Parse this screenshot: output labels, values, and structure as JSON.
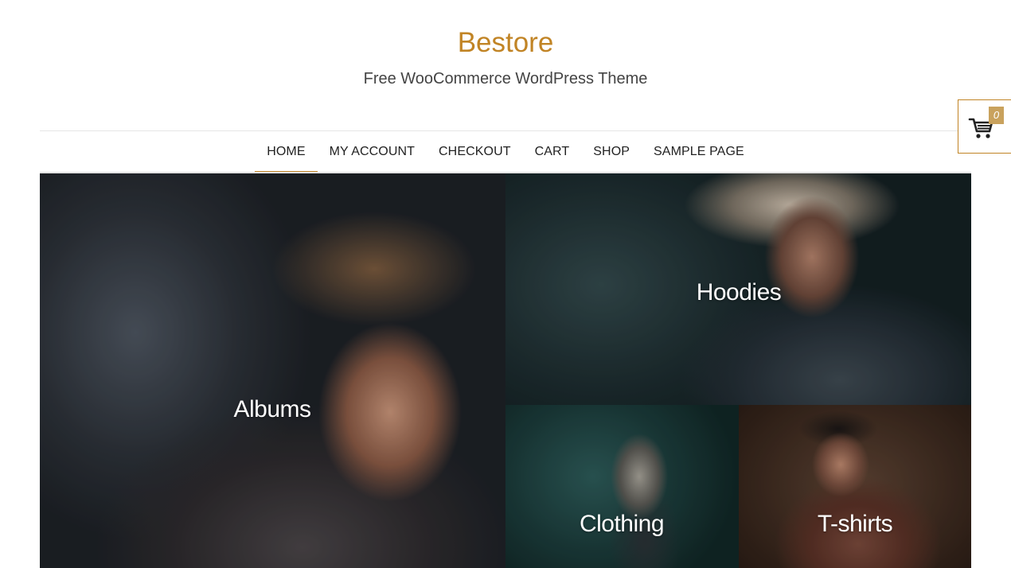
{
  "site": {
    "title": "Bestore",
    "tagline": "Free WooCommerce WordPress Theme"
  },
  "nav": {
    "items": [
      {
        "label": "HOME",
        "active": true
      },
      {
        "label": "MY ACCOUNT",
        "active": false
      },
      {
        "label": "CHECKOUT",
        "active": false
      },
      {
        "label": "CART",
        "active": false
      },
      {
        "label": "SHOP",
        "active": false
      },
      {
        "label": "SAMPLE PAGE",
        "active": false
      }
    ]
  },
  "cart": {
    "icon": "shopping-cart-icon",
    "count": "0"
  },
  "categories": [
    {
      "label": "Albums"
    },
    {
      "label": "Hoodies"
    },
    {
      "label": "Clothing"
    },
    {
      "label": "T-shirts"
    }
  ],
  "colors": {
    "accent": "#c18425",
    "badge": "#c9a25d",
    "text": "#222222",
    "tagline": "#444444"
  }
}
